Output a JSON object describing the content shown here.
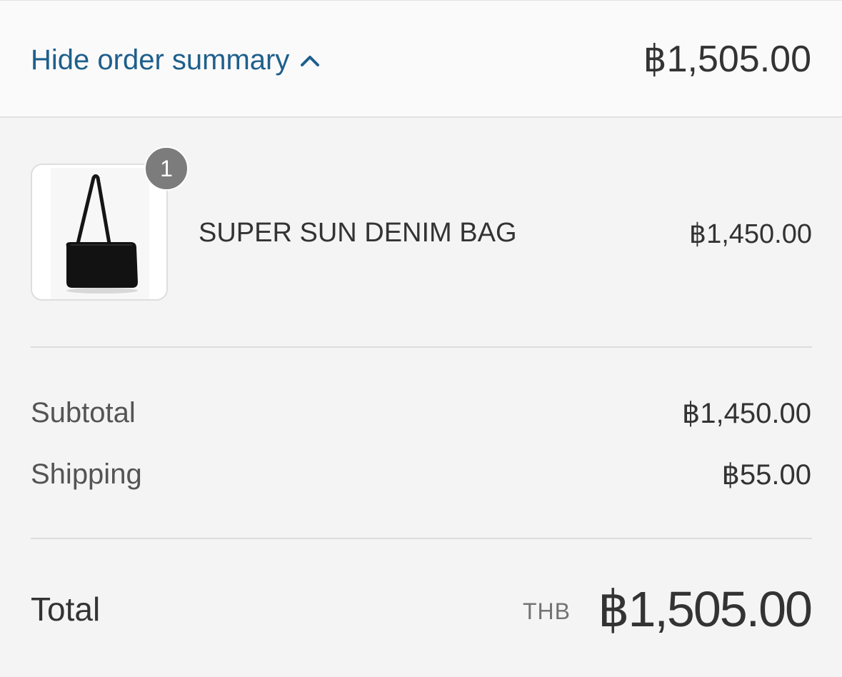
{
  "header": {
    "toggle_label": "Hide order summary",
    "toggle_icon": "chevron-up-icon",
    "total": "฿1,505.00",
    "accent_color": "#1e5f8c"
  },
  "items": [
    {
      "name": "SUPER SUN DENIM BAG",
      "price": "฿1,450.00",
      "quantity": "1",
      "thumbnail": "black-tote-bag-image"
    }
  ],
  "summary": {
    "subtotal_label": "Subtotal",
    "subtotal_value": "฿1,450.00",
    "shipping_label": "Shipping",
    "shipping_value": "฿55.00"
  },
  "total": {
    "label": "Total",
    "currency": "THB",
    "amount": "฿1,505.00"
  }
}
